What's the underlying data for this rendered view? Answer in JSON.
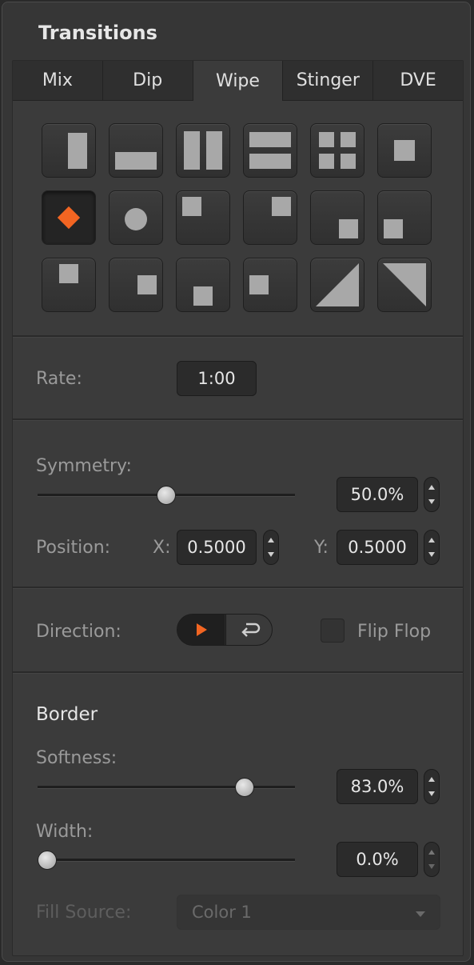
{
  "panel": {
    "title": "Transitions"
  },
  "tabs": [
    {
      "label": "Mix"
    },
    {
      "label": "Dip"
    },
    {
      "label": "Wipe",
      "active": true
    },
    {
      "label": "Stinger"
    },
    {
      "label": "DVE"
    }
  ],
  "patterns": {
    "selected": "diamond",
    "accent_color": "#f26522",
    "items": [
      "vertical-bar",
      "horizontal-bar",
      "double-vertical",
      "double-horizontal",
      "four-quad",
      "center-square",
      "diamond",
      "circle",
      "top-left-square",
      "top-right-square",
      "bottom-right-square",
      "bottom-left-square",
      "top-center-square",
      "right-center-square",
      "bottom-center-square",
      "left-center-square",
      "diagonal-bl",
      "diagonal-br"
    ]
  },
  "rate": {
    "label": "Rate:",
    "value": "1:00"
  },
  "symmetry": {
    "label": "Symmetry:",
    "value": "50.0%",
    "fraction": 0.5
  },
  "position": {
    "label": "Position:",
    "x_label": "X:",
    "x_value": "0.5000",
    "y_label": "Y:",
    "y_value": "0.5000"
  },
  "direction": {
    "label": "Direction:",
    "flip_flop_label": "Flip Flop",
    "flip_flop_checked": false
  },
  "border": {
    "heading": "Border",
    "softness": {
      "label": "Softness:",
      "value": "83.0%",
      "fraction": 0.83
    },
    "width": {
      "label": "Width:",
      "value": "0.0%",
      "fraction": 0.0
    },
    "fill_source": {
      "label": "Fill Source:",
      "value": "Color 1"
    }
  }
}
